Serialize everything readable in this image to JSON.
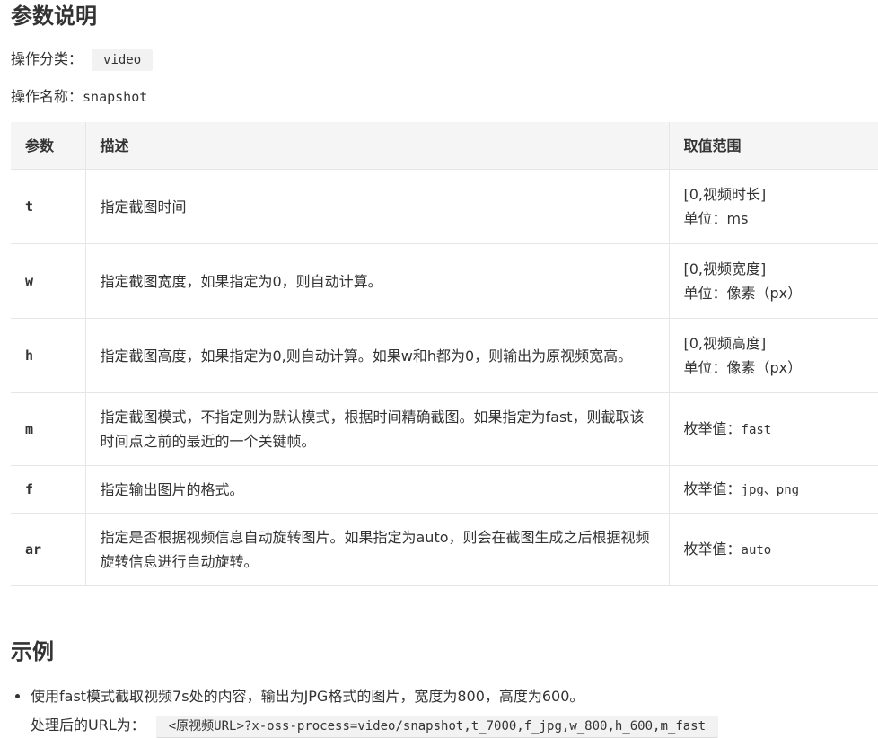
{
  "section_params": {
    "title": "参数说明",
    "op_category_label": "操作分类：",
    "op_category_value": "video",
    "op_name_label": "操作名称：",
    "op_name_value": "snapshot"
  },
  "table": {
    "headers": [
      "参数",
      "描述",
      "取值范围"
    ],
    "rows": [
      {
        "param": "t",
        "desc": "指定截图时间",
        "range_lines": [
          "[0,视频时长]",
          "单位：ms"
        ]
      },
      {
        "param": "w",
        "desc": "指定截图宽度，如果指定为0，则自动计算。",
        "range_lines": [
          "[0,视频宽度]",
          "单位：像素（px）"
        ]
      },
      {
        "param": "h",
        "desc": "指定截图高度，如果指定为0,则自动计算。如果w和h都为0，则输出为原视频宽高。",
        "range_lines": [
          "[0,视频高度]",
          "单位：像素（px）"
        ]
      },
      {
        "param": "m",
        "desc": "指定截图模式，不指定则为默认模式，根据时间精确截图。如果指定为fast，则截取该时间点之前的最近的一个关键帧。",
        "range_label": "枚举值：",
        "range_code": "fast"
      },
      {
        "param": "f",
        "desc": "指定输出图片的格式。",
        "range_label": "枚举值：",
        "range_code": "jpg、png"
      },
      {
        "param": "ar",
        "desc": "指定是否根据视频信息自动旋转图片。如果指定为auto，则会在截图生成之后根据视频旋转信息进行自动旋转。",
        "range_label": "枚举值：",
        "range_code": "auto"
      }
    ]
  },
  "section_example": {
    "title": "示例",
    "item_text": "使用fast模式截取视频7s处的内容，输出为JPG格式的图片，宽度为800，高度为600。",
    "url_label": "处理后的URL为：",
    "url_code": "<原视频URL>?x-oss-process=video/snapshot,t_7000,f_jpg,w_800,h_600,m_fast"
  }
}
